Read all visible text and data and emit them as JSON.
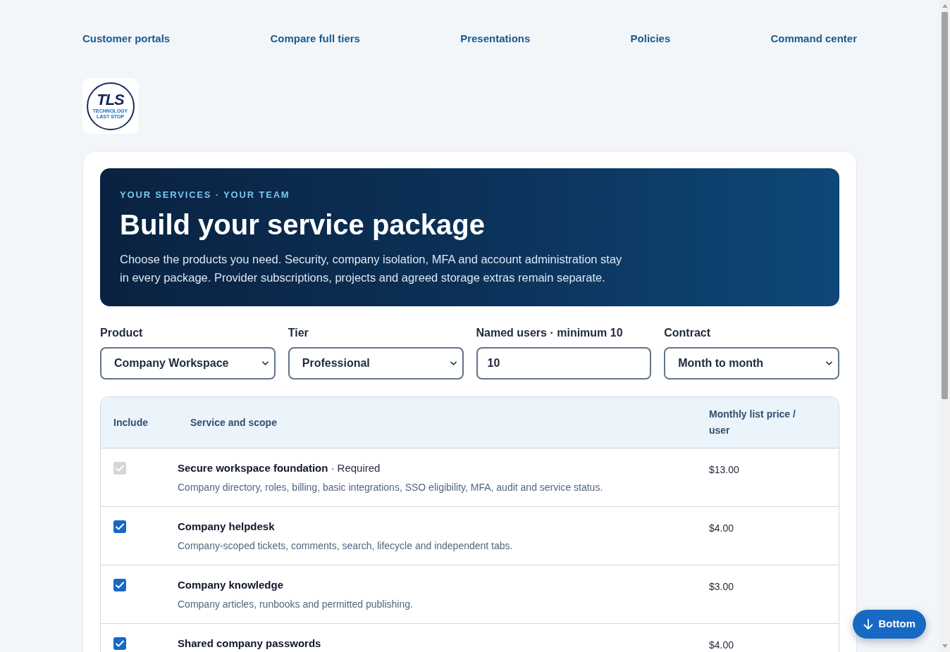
{
  "nav": {
    "links": [
      "Customer portals",
      "Compare full tiers",
      "Presentations",
      "Policies",
      "Command center"
    ]
  },
  "logo": {
    "monogram": "TLS",
    "tagline": "TECHNOLOGY LAST STOP"
  },
  "hero": {
    "eyebrow": "YOUR SERVICES · YOUR TEAM",
    "title": "Build your service package",
    "description": "Choose the products you need. Security, company isolation, MFA and account administration stay in every package. Provider subscriptions, projects and agreed storage extras remain separate."
  },
  "form": {
    "fields": [
      {
        "label": "Product",
        "kind": "select",
        "value": "Company Workspace"
      },
      {
        "label": "Tier",
        "kind": "select",
        "value": "Professional"
      },
      {
        "label": "Named users · minimum 10",
        "kind": "number",
        "value": "10"
      },
      {
        "label": "Contract",
        "kind": "select",
        "value": "Month to month"
      }
    ]
  },
  "table": {
    "columns": [
      "Include",
      "Service and scope",
      "Monthly list price / user"
    ],
    "rows": [
      {
        "checked": true,
        "disabled": true,
        "name": "Secure workspace foundation",
        "note": "· Required",
        "description": "Company directory, roles, billing, basic integrations, SSO eligibility, MFA, audit and service status.",
        "price": "$13.00"
      },
      {
        "checked": true,
        "disabled": false,
        "name": "Company helpdesk",
        "description": "Company-scoped tickets, comments, search, lifecycle and independent tabs.",
        "price": "$4.00"
      },
      {
        "checked": true,
        "disabled": false,
        "name": "Company knowledge",
        "description": "Company articles, runbooks and permitted publishing.",
        "price": "$3.00"
      },
      {
        "checked": true,
        "disabled": false,
        "name": "Shared company passwords",
        "price": "$4.00"
      }
    ]
  },
  "bottom_button": {
    "label": "Bottom"
  }
}
